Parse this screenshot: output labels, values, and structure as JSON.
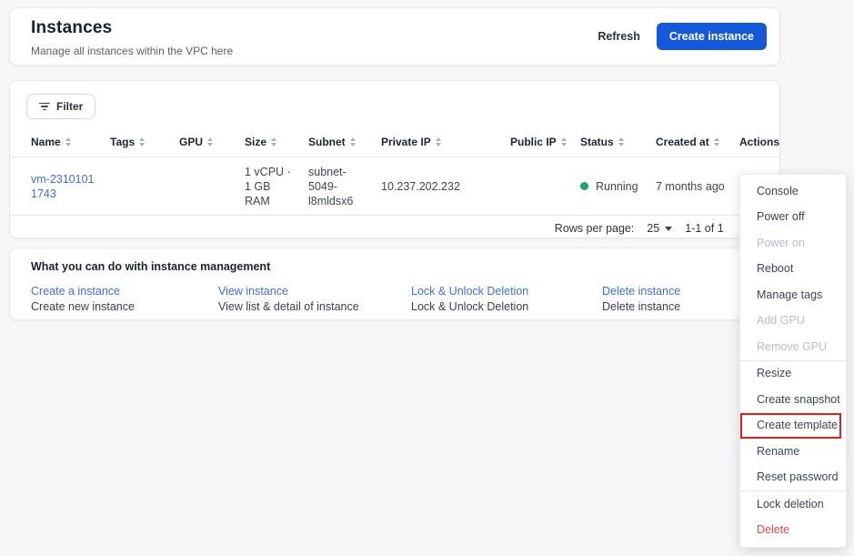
{
  "page": {
    "accent_blue": "#1459d9",
    "link_blue": "#3e6fd9",
    "status_green": "#21a36c",
    "danger_red": "#e5484d",
    "highlight_red": "#dd1f1f"
  },
  "header": {
    "title": "Instances",
    "subtitle": "Manage all instances within the VPC here",
    "refresh_label": "Refresh",
    "create_label": "Create instance"
  },
  "table": {
    "filter_label": "Filter",
    "columns": [
      {
        "label": "Name",
        "sortable": true
      },
      {
        "label": "Tags",
        "sortable": true
      },
      {
        "label": "GPU",
        "sortable": true
      },
      {
        "label": "Size",
        "sortable": true
      },
      {
        "label": "Subnet",
        "sortable": true
      },
      {
        "label": "Private IP",
        "sortable": true
      },
      {
        "label": "Public IP",
        "sortable": true
      },
      {
        "label": "Status",
        "sortable": true
      },
      {
        "label": "Created at",
        "sortable": true
      },
      {
        "label": "Actions",
        "sortable": false
      }
    ],
    "row": {
      "name": "vm-23101011743",
      "tags": "",
      "gpu": "",
      "size": "1 vCPU · 1 GB RAM",
      "subnet": "subnet-5049-l8mldsx6",
      "private_ip": "10.237.202.232",
      "public_ip": "",
      "status": "Running",
      "created_at": "7 months ago"
    },
    "pagination": {
      "rows_per_page_label": "Rows per page:",
      "rows_per_page_value": "25",
      "range": "1-1 of 1"
    }
  },
  "info": {
    "title": "What you can do with instance management",
    "links": [
      {
        "label": "Create a instance",
        "description": "Create new instance"
      },
      {
        "label": "View instance",
        "description": "View list & detail of instance"
      },
      {
        "label": "Lock & Unlock Deletion",
        "description": "Lock & Unlock Deletion"
      },
      {
        "label": "Delete instance",
        "description": "Delete instance"
      }
    ]
  },
  "menu": {
    "items": [
      {
        "label": "Console"
      },
      {
        "label": "Power off"
      },
      {
        "label": "Power on",
        "disabled": true
      },
      {
        "label": "Reboot"
      },
      {
        "label": "Manage tags"
      },
      {
        "label": "Add GPU",
        "disabled": true
      },
      {
        "label": "Remove GPU",
        "disabled": true
      },
      {
        "label": "Resize"
      },
      {
        "label": "Create snapshot"
      },
      {
        "label": "Create template",
        "highlighted": true
      },
      {
        "label": "Rename"
      },
      {
        "label": "Reset password"
      },
      {
        "label": "Lock deletion"
      },
      {
        "label": "Delete",
        "danger": true
      }
    ]
  },
  "icons": {
    "prev": "‹",
    "next": "›"
  }
}
